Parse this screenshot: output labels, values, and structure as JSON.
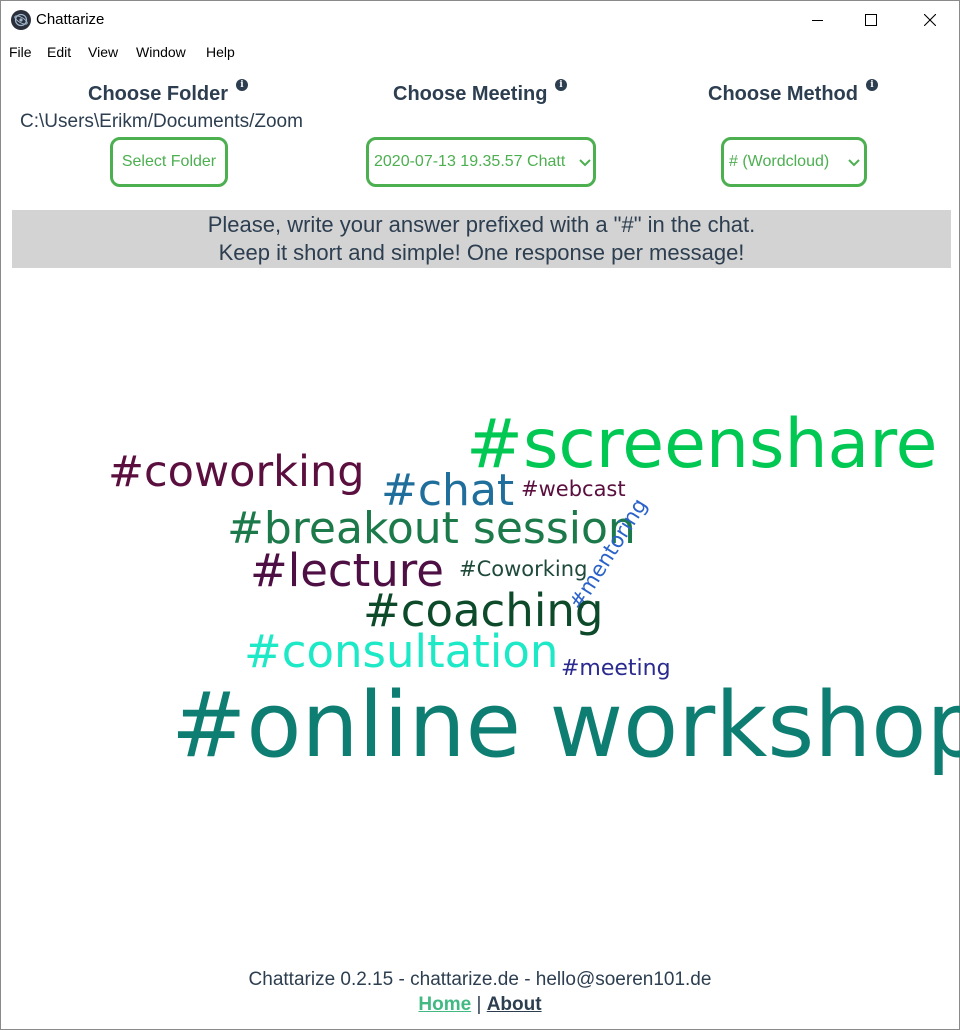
{
  "window": {
    "title": "Chattarize"
  },
  "menu": [
    "File",
    "Edit",
    "View",
    "Window",
    "Help"
  ],
  "folder": {
    "title": "Choose Folder",
    "path": "C:\\Users\\Erikm/Documents/Zoom",
    "button_label": "Select Folder"
  },
  "meeting": {
    "title": "Choose Meeting",
    "selected": "2020-07-13 19.35.57 Chatt"
  },
  "method": {
    "title": "Choose Method",
    "selected": "# (Wordcloud)"
  },
  "info_glyph": "i",
  "banner": {
    "line1": "Please, write your answer prefixed with a \"#\" in the chat.",
    "line2": "Keep it short and simple! One response per message!"
  },
  "wordcloud": {
    "words": [
      {
        "text": "#screenshare",
        "color": "#00c853"
      },
      {
        "text": "#coworking",
        "color": "#5b0f3f"
      },
      {
        "text": "#chat",
        "color": "#1f6e9c"
      },
      {
        "text": "#webcast",
        "color": "#5b0f3f"
      },
      {
        "text": "#breakout session",
        "color": "#1c7a4a"
      },
      {
        "text": "#mentoring",
        "color": "#2a62c9"
      },
      {
        "text": "#lecture",
        "color": "#4e0f45"
      },
      {
        "text": "#Coworking",
        "color": "#1f4a3a"
      },
      {
        "text": "#coaching",
        "color": "#0c4a2a"
      },
      {
        "text": "#consultation",
        "color": "#1de9c6"
      },
      {
        "text": "#meeting",
        "color": "#2a2a8f"
      },
      {
        "text": "#online workshop",
        "color": "#0e7e72"
      }
    ]
  },
  "footer": {
    "version_text": "Chattarize 0.2.15 - chattarize.de - hello@soeren101.de",
    "home_label": "Home",
    "separator": " | ",
    "about_label": "About"
  },
  "colors": {
    "accent_green": "#4caf50",
    "link_green": "#42b983",
    "text_dark": "#2c3e50",
    "banner_bg": "#d3d3d3"
  }
}
